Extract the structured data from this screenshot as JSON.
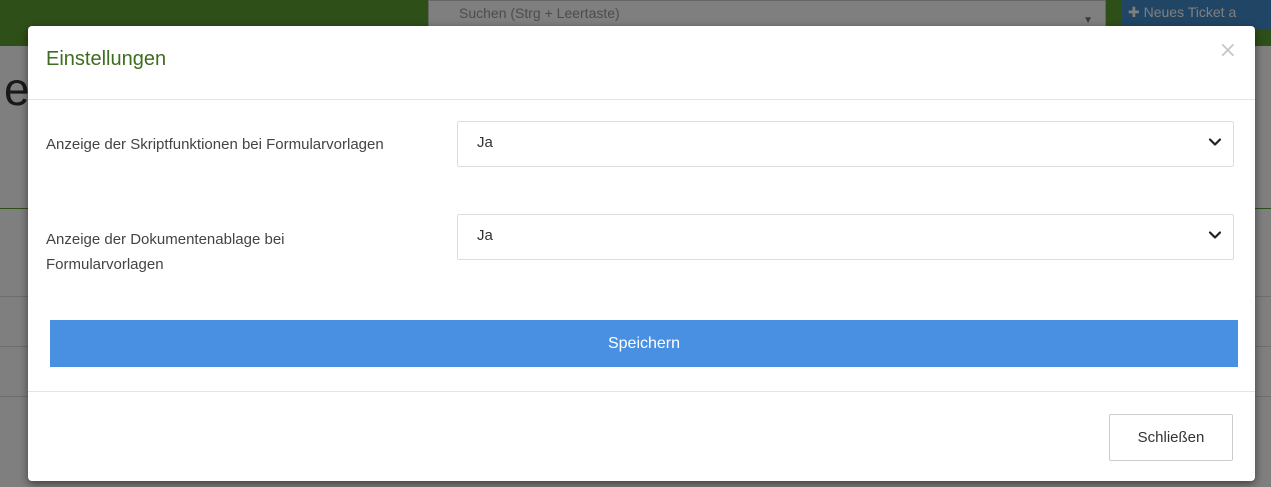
{
  "background": {
    "search_placeholder": "Suchen (Strg + Leertaste)",
    "new_ticket_label": "Neues Ticket a",
    "heading_fragment": "e"
  },
  "modal": {
    "title": "Einstellungen",
    "close_symbol": "×",
    "fields": [
      {
        "label": "Anzeige der Skriptfunktionen bei Formularvorlagen",
        "value": "Ja"
      },
      {
        "label": "Anzeige der Dokumentenablage bei Formularvorlagen",
        "value": "Ja"
      }
    ],
    "save_label": "Speichern",
    "footer_close_label": "Schließen"
  },
  "colors": {
    "title_green": "#3d6e1f",
    "save_blue": "#4a90e2",
    "topbar_green": "#5c9e31"
  }
}
